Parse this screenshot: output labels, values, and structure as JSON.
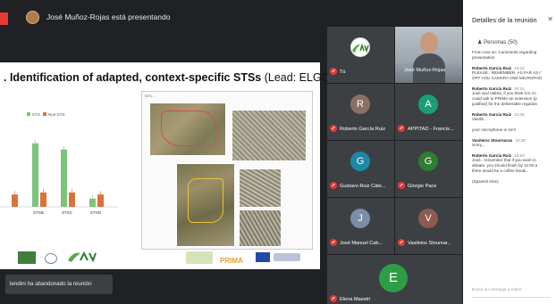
{
  "presenter": {
    "text": "José Muñoz-Rojas está presentando"
  },
  "slide": {
    "title": ". Identification of adapted, context-specific STSs",
    "lead": "(Lead: ELGO)",
    "photos_label": "STS...",
    "logo_text": "PRIMA",
    "chart": {
      "legend": [
        "STS",
        "Non-STS"
      ],
      "categories": [
        "",
        "STSB",
        "STSC",
        "STSD"
      ]
    }
  },
  "chart_data": {
    "type": "bar",
    "categories": [
      "",
      "STSB",
      "STSC",
      "STSD"
    ],
    "series": [
      {
        "name": "STS",
        "values": [
          0,
          62,
          56,
          8
        ]
      },
      {
        "name": "Non-STS",
        "values": [
          12,
          14,
          14,
          12
        ]
      }
    ],
    "ylim": [
      0,
      80
    ],
    "colors": [
      "#7cc47c",
      "#d9733a"
    ]
  },
  "notice": {
    "text": "lendini ha abandonado la reunión"
  },
  "participants": [
    {
      "initial": "",
      "name": "Tú",
      "color": "#ffffff",
      "logo": true
    },
    {
      "initial": "",
      "name": "José Muñoz-Rojas",
      "color": "#7b8794",
      "video": true
    },
    {
      "initial": "R",
      "name": "Roberto García Ruiz",
      "color": "#8d6e63"
    },
    {
      "initial": "A",
      "name": "APPITAD - Francis...",
      "color": "#1b9e77"
    },
    {
      "initial": "G",
      "name": "Gustavo Ruiz Cáte...",
      "color": "#1e88a8"
    },
    {
      "initial": "G",
      "name": "Giorgio Pace",
      "color": "#2e7d32"
    },
    {
      "initial": "J",
      "name": "José Manuel Cab...",
      "color": "#7a8fa6"
    },
    {
      "initial": "V",
      "name": "Vasileios Stoumar...",
      "color": "#8d5a4f"
    },
    {
      "initial": "E",
      "name": "Elena Maestri",
      "color": "#2e9e46"
    }
  ],
  "panel": {
    "title": "Detalles de la reunión",
    "people": "Personas (50)",
    "messages": [
      {
        "sender": "",
        "time": "",
        "lines": [
          "From now on: Comments regarding",
          "presentation"
        ]
      },
      {
        "sender": "Roberto García Ruiz",
        "time": "10:23",
        "lines": [
          "PLEASE.. REMEMBER, AS FAR AS I'",
          "OFF YOU CAMARA AND MICROPHO"
        ]
      },
      {
        "sender": "Roberto García Ruiz",
        "time": "10:24",
        "lines": [
          "José and Valisis, if you think it is co",
          "could ask to PRIMA an extension (p",
          "justified) for the deliverable regardin"
        ]
      },
      {
        "sender": "Roberto García Ruiz",
        "time": "10:35",
        "lines": [
          "Vasilis..."
        ]
      },
      {
        "sender": "",
        "time": "",
        "lines": [
          "your microphone is on!!!"
        ]
      },
      {
        "sender": "Vasileios Stournaras",
        "time": "10:38",
        "lines": [
          "Sorry..."
        ]
      },
      {
        "sender": "Roberto García Ruiz",
        "time": "10:50",
        "lines": [
          "José.. remember that if you want to",
          "debate, you should finish by 11:00 a",
          "there would be a coffee break.."
        ]
      },
      {
        "sender": "",
        "time": "",
        "lines": [
          "(Spanish time)"
        ]
      }
    ],
    "input_placeholder": "Envía un mensaje a todos"
  }
}
